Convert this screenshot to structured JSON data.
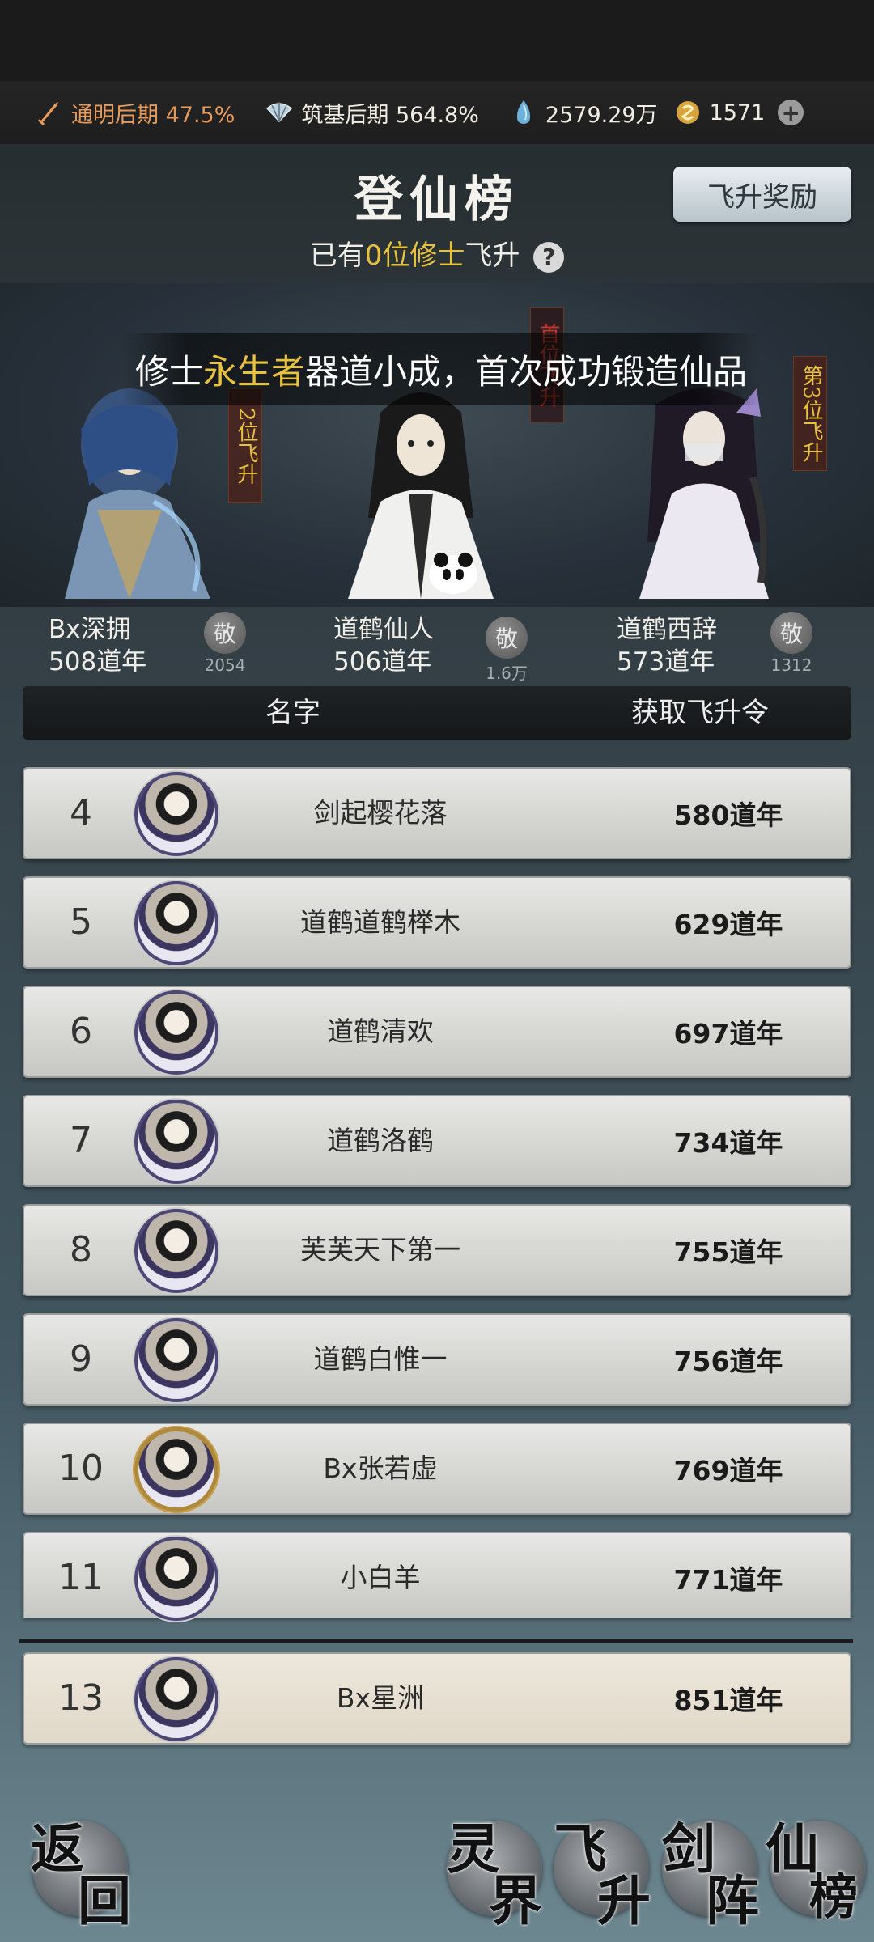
{
  "resources": {
    "cultivation_a_label": "通明后期 47.5%",
    "cultivation_b_label": "筑基后期 564.8%",
    "spirit_stones": "2579.29万",
    "gold": "1571"
  },
  "page": {
    "title": "登仙榜",
    "reward_button": "飞升奖励",
    "subtitle_prefix": "已有",
    "subtitle_count": "0位修士",
    "subtitle_suffix": "飞升",
    "help_icon": "?"
  },
  "news": {
    "prefix": "修士",
    "highlight": "永生者",
    "suffix": "器道小成，首次成功锻造仙品"
  },
  "podium": [
    {
      "rank_tag": "2位飞升",
      "name": "Bx深拥",
      "years": "508道年",
      "respect_label": "敬",
      "respect_count": "2054"
    },
    {
      "rank_tag": "首位飞升",
      "name": "道鹤仙人",
      "years": "506道年",
      "respect_label": "敬",
      "respect_count": "1.6万"
    },
    {
      "rank_tag": "第3位飞升",
      "name": "道鹤西辞",
      "years": "573道年",
      "respect_label": "敬",
      "respect_count": "1312"
    }
  ],
  "table": {
    "col_name": "名字",
    "col_value": "获取飞升令",
    "rows": [
      {
        "rank": "4",
        "name": "剑起樱花落",
        "years": "580道年"
      },
      {
        "rank": "5",
        "name": "道鹤道鹤榉木",
        "years": "629道年"
      },
      {
        "rank": "6",
        "name": "道鹤清欢",
        "years": "697道年"
      },
      {
        "rank": "7",
        "name": "道鹤洛鹤",
        "years": "734道年"
      },
      {
        "rank": "8",
        "name": "芙芙天下第一",
        "years": "755道年"
      },
      {
        "rank": "9",
        "name": "道鹤白惟一",
        "years": "756道年"
      },
      {
        "rank": "10",
        "name": "Bx张若虚",
        "years": "769道年"
      },
      {
        "rank": "11",
        "name": "小白羊",
        "years": "771道年"
      }
    ],
    "self_row": {
      "rank": "13",
      "name": "Bx星洲",
      "years": "851道年"
    }
  },
  "nav": {
    "back": [
      "返",
      "回"
    ],
    "spirit_realm": [
      "灵",
      "界"
    ],
    "ascension": [
      "飞",
      "升"
    ],
    "sword_array": [
      "剑",
      "阵"
    ],
    "immortal_board": [
      "仙",
      "榜"
    ]
  },
  "colors": {
    "highlight_gold": "#e8c23f",
    "cultivation_orange": "#e89a5b"
  }
}
